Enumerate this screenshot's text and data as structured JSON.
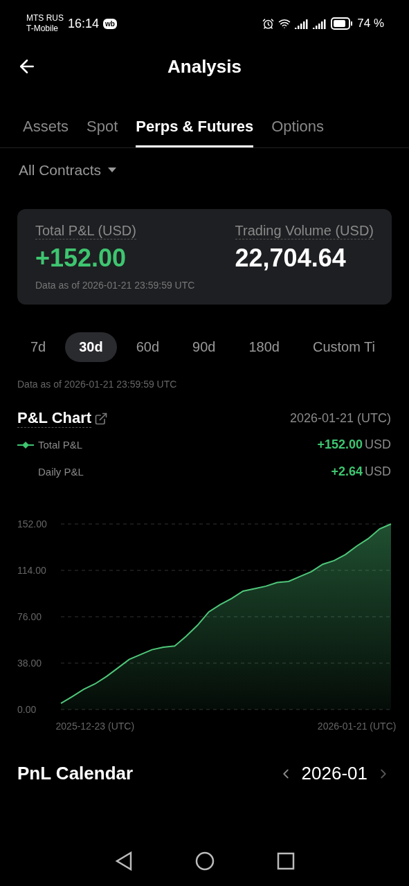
{
  "status_bar": {
    "carrier_1": "MTS RUS",
    "carrier_2": "T-Mobile",
    "time": "16:14",
    "app_badge": "wb",
    "battery": "74 %"
  },
  "header": {
    "title": "Analysis"
  },
  "tabs": [
    {
      "label": "Assets",
      "selected": false
    },
    {
      "label": "Spot",
      "selected": false
    },
    {
      "label": "Perps & Futures",
      "selected": true
    },
    {
      "label": "Options",
      "selected": false
    }
  ],
  "filter": {
    "label": "All Contracts"
  },
  "summary": {
    "pnl_label": "Total P&L (USD)",
    "pnl_value": "+152.00",
    "volume_label": "Trading Volume (USD)",
    "volume_value": "22,704.64",
    "note": "Data as of 2026-01-21 23:59:59 UTC"
  },
  "periods": [
    {
      "label": "7d",
      "selected": false
    },
    {
      "label": "30d",
      "selected": true
    },
    {
      "label": "60d",
      "selected": false
    },
    {
      "label": "90d",
      "selected": false
    },
    {
      "label": "180d",
      "selected": false
    },
    {
      "label": "Custom Ti",
      "selected": false
    }
  ],
  "period_note": "Data as of 2026-01-21 23:59:59 UTC",
  "pnl_chart": {
    "title": "P&L Chart",
    "date": "2026-01-21 (UTC)",
    "legend": [
      {
        "kind": "line",
        "value": "+152.00",
        "unit": "USD"
      },
      {
        "kind": "plain",
        "label": "Daily P&L",
        "value": "+2.64",
        "unit": "USD"
      }
    ],
    "chart_data": {
      "type": "area",
      "grid": true,
      "categories": [
        null,
        null,
        null,
        "2025-12-23 (UTC)",
        null,
        null,
        null,
        null,
        null,
        null,
        null,
        null,
        null,
        null,
        null,
        null,
        null,
        null,
        null,
        null,
        null,
        null,
        null,
        null,
        null,
        null,
        "2026-01-21 (UTC)",
        null,
        null,
        null
      ],
      "series": [
        {
          "name": "Total P&L",
          "color": "#4fc77a",
          "values": [
            5,
            10.6,
            16.5,
            21,
            27,
            34,
            41,
            45,
            49,
            51,
            52,
            60,
            69,
            80,
            86,
            91,
            97,
            99,
            101,
            104,
            105,
            109,
            113,
            119,
            122,
            127,
            134,
            140,
            148,
            152
          ]
        }
      ],
      "ylim": [
        0,
        152
      ],
      "yticks": [
        {
          "value": 152,
          "label": "152.00"
        },
        {
          "value": 114,
          "label": "114.00"
        },
        {
          "value": 76,
          "label": "76.00"
        },
        {
          "value": 38,
          "label": "38.00"
        },
        {
          "value": 0,
          "label": "0.00"
        }
      ]
    }
  },
  "calendar": {
    "title": "PnL Calendar",
    "month": "2026-01"
  }
}
